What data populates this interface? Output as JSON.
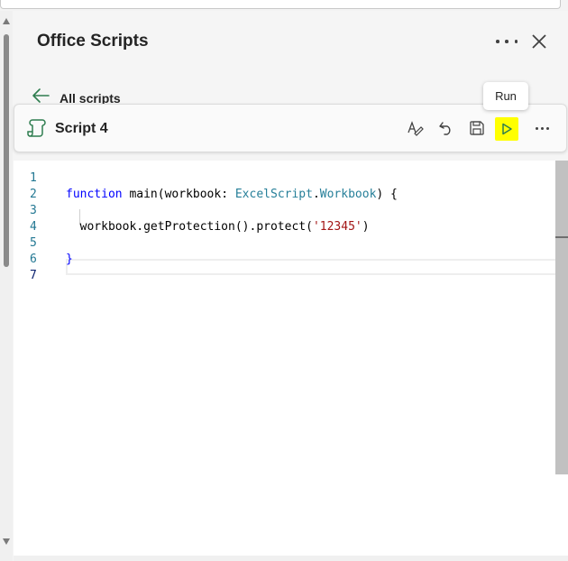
{
  "panel": {
    "title": "Office Scripts"
  },
  "nav": {
    "back_label": "All scripts"
  },
  "script": {
    "name": "Script 4",
    "toolbar": {
      "icons": [
        "spellcheck-icon",
        "undo-icon",
        "save-icon",
        "run-icon",
        "more-icon"
      ],
      "highlight_color": "#ffff00"
    }
  },
  "tooltip": {
    "text": "Run"
  },
  "editor": {
    "line_numbers": [
      "1",
      "2",
      "3",
      "4",
      "5",
      "6",
      "7"
    ],
    "lines": [
      {
        "parts": []
      },
      {
        "parts": [
          {
            "t": "function",
            "c": "kw"
          },
          {
            "t": " main(workbook: ",
            "c": "fn"
          },
          {
            "t": "ExcelScript",
            "c": "ty"
          },
          {
            "t": ".",
            "c": "fn"
          },
          {
            "t": "Workbook",
            "c": "ty"
          },
          {
            "t": ") {",
            "c": "fn"
          }
        ]
      },
      {
        "parts": []
      },
      {
        "parts": [
          {
            "t": "  workbook.getProtection().protect(",
            "c": "fn"
          },
          {
            "t": "'12345'",
            "c": "str"
          },
          {
            "t": ")",
            "c": "fn"
          }
        ]
      },
      {
        "parts": []
      },
      {
        "parts": [
          {
            "t": "}",
            "c": "kw"
          }
        ]
      },
      {
        "parts": []
      }
    ],
    "active_line": 7
  }
}
